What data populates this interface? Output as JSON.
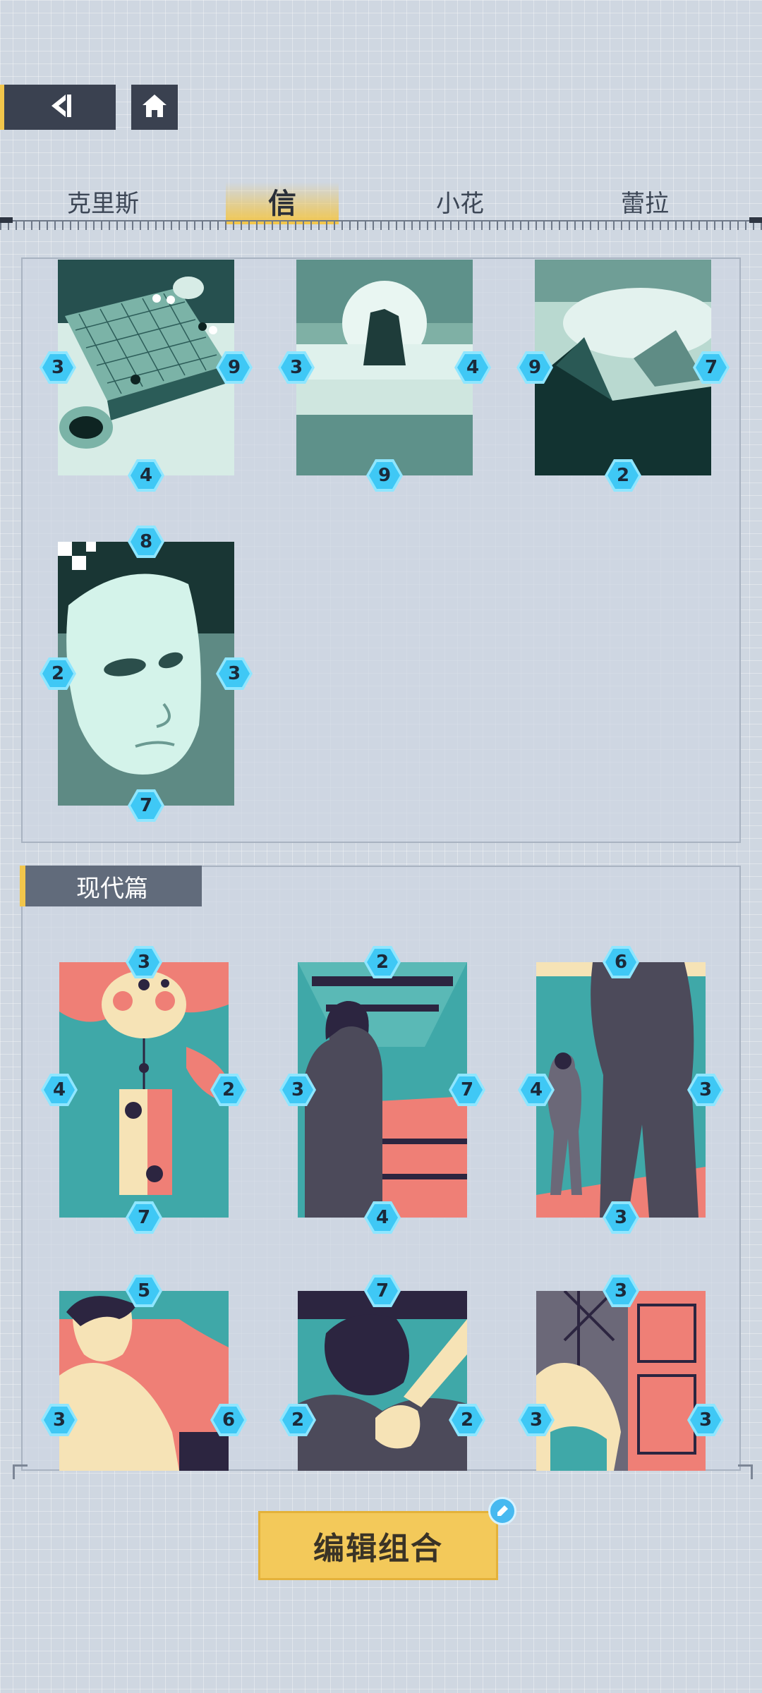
{
  "nav": {
    "back_icon": "back-arrow-icon",
    "home_icon": "home-icon"
  },
  "tabs": [
    {
      "label": "克里斯"
    },
    {
      "label": "信"
    },
    {
      "label": "小花"
    },
    {
      "label": "蕾拉"
    }
  ],
  "active_tab_index": 1,
  "section_modern": {
    "label": "现代篇"
  },
  "cards_top": [
    {
      "subject": "go board",
      "top": "",
      "left": "3",
      "right": "9",
      "bottom": "4"
    },
    {
      "subject": "ship in moonlight",
      "top": "",
      "left": "3",
      "right": "4",
      "bottom": "9"
    },
    {
      "subject": "battlefield tent",
      "top": "",
      "left": "9",
      "right": "7",
      "bottom": "2"
    },
    {
      "subject": "white mask",
      "top": "8",
      "left": "2",
      "right": "3",
      "bottom": "7"
    }
  ],
  "cards_modern": [
    {
      "subject": "wind chime",
      "top": "3",
      "left": "4",
      "right": "2",
      "bottom": "7"
    },
    {
      "subject": "man in corridor",
      "top": "2",
      "left": "3",
      "right": "7",
      "bottom": "4"
    },
    {
      "subject": "two men standing",
      "top": "6",
      "left": "4",
      "right": "3",
      "bottom": "3"
    },
    {
      "subject": "young man sitting",
      "top": "5",
      "left": "3",
      "right": "6",
      "bottom": ""
    },
    {
      "subject": "man with fist",
      "top": "7",
      "left": "2",
      "right": "2",
      "bottom": ""
    },
    {
      "subject": "woman at door",
      "top": "3",
      "left": "3",
      "right": "3",
      "bottom": ""
    }
  ],
  "edit_button": {
    "label": "编辑组合"
  },
  "colors": {
    "accent": "#f2c64b",
    "hex_badge": "#3fc8f5",
    "panel": "#cdd6e2",
    "teal_art": "#2f6f6c",
    "pink_art": "#ef7f76"
  }
}
